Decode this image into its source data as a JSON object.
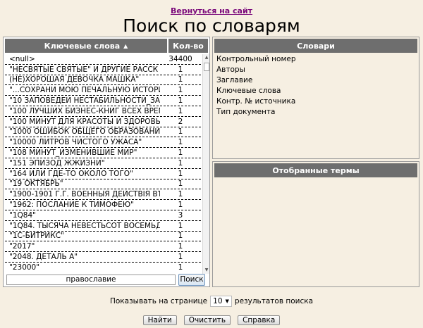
{
  "header": {
    "back_link": "Вернуться на сайт",
    "title": "Поиск по словарям"
  },
  "keywords_panel": {
    "col_keywords": "Ключевые слова",
    "col_count": "Кол-во",
    "rows": [
      {
        "keyword": "<null>",
        "count": "34400"
      },
      {
        "keyword": "\"НЕСВЯТЫЕ СВЯТЫЕ\" И ДРУГИЕ РАССК",
        "count": "1"
      },
      {
        "keyword": "(НЕ)ХОРОШАЯ ДЕВОЧКА МАШКА\"",
        "count": "1"
      },
      {
        "keyword": "\"...СОХРАНИ МОЮ ПЕЧАЛЬНУЮ ИСТОРИ",
        "count": "1"
      },
      {
        "keyword": "\"10 ЗАПОВЕДЕЙ НЕСТАБИЛЬНОСТИ_ЗА",
        "count": "1"
      },
      {
        "keyword": "\"100 ЛУЧШИХ БИЗНЕС-КНИГ ВСЕХ ВРЕМ",
        "count": "1"
      },
      {
        "keyword": "\"100 МИНУТ ДЛЯ КРАСОТЫ И ЗДОРОВЬЯ",
        "count": "2"
      },
      {
        "keyword": "\"1000 ОШИБОК ОБЩЕГО ОБРАЗОВАНИЯ",
        "count": "1"
      },
      {
        "keyword": "\"10000 ЛИТРОВ ЧИСТОГО УЖАСА\"",
        "count": "1"
      },
      {
        "keyword": "\"108 МИНУТ_ИЗМЕНИВШИЕ МИР\"",
        "count": "1"
      },
      {
        "keyword": "\"151 ЭПИЗОД ЖЖИЗНИ\"",
        "count": "1"
      },
      {
        "keyword": "\"164 ИЛИ ГДЕ-ТО ОКОЛО ТОГО\"",
        "count": "1"
      },
      {
        "keyword": "\"19 ОКТЯБРЬ\"",
        "count": "1"
      },
      {
        "keyword": "\"1900-1901 Г.Г. ВОЕННЫЯ ДЕЙСТВІЯ ВЪ",
        "count": "1"
      },
      {
        "keyword": "\"1962: ПОСЛАНИЕ К ТИМОФЕЮ\"",
        "count": "1"
      },
      {
        "keyword": "\"1Q84\"",
        "count": "3"
      },
      {
        "keyword": "\"1Q84. ТЫСЯЧА НЕВЕСТЬСОТ ВОСЕМЬД",
        "count": "1"
      },
      {
        "keyword": "\"1С-БИТРИКС\"",
        "count": "1"
      },
      {
        "keyword": "\"2017\"",
        "count": "1"
      },
      {
        "keyword": "\"2048. ДЕТАЛЬ А\"",
        "count": "1"
      },
      {
        "keyword": "\"23000\"",
        "count": "1"
      }
    ],
    "search_value": "православие",
    "search_button": "Поиск"
  },
  "dictionaries_panel": {
    "title": "Словари",
    "items": [
      "Контрольный номер",
      "Авторы",
      "Заглавие",
      "Ключевые слова",
      "Контр. № источника",
      "Тип документа"
    ]
  },
  "terms_panel": {
    "title": "Отобранные термы"
  },
  "footer": {
    "per_page_prefix": "Показывать на странице",
    "per_page_value": "10",
    "per_page_suffix": "результатов поиска",
    "find_button": "Найти",
    "clear_button": "Очистить",
    "help_button": "Справка"
  }
}
